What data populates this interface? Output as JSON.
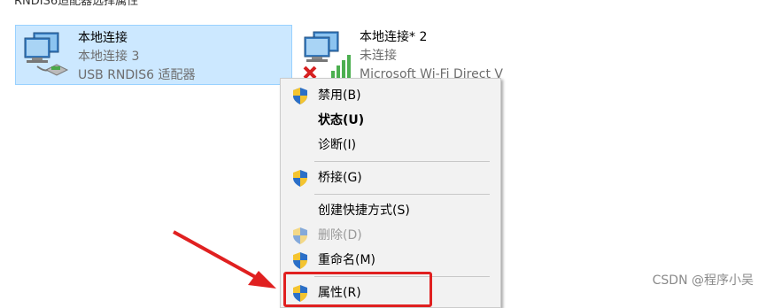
{
  "top_caption": "RNDIS6适配器选择属性",
  "adapters": [
    {
      "name": "本地连接",
      "status": "本地连接 3",
      "device": "USB RNDIS6 适配器",
      "selected": true
    },
    {
      "name": "本地连接* 2",
      "status": "未连接",
      "device": "Microsoft Wi-Fi Direct V",
      "selected": false
    }
  ],
  "context_menu": {
    "items": [
      {
        "label": "禁用(B)",
        "icon": "uac-shield-icon",
        "bold": false,
        "disabled": false
      },
      {
        "label": "状态(U)",
        "icon": "",
        "bold": true,
        "disabled": false
      },
      {
        "label": "诊断(I)",
        "icon": "",
        "bold": false,
        "disabled": false
      },
      {
        "label": "桥接(G)",
        "icon": "uac-shield-icon",
        "bold": false,
        "disabled": false
      },
      {
        "label": "创建快捷方式(S)",
        "icon": "",
        "bold": false,
        "disabled": false
      },
      {
        "label": "删除(D)",
        "icon": "uac-shield-icon",
        "bold": false,
        "disabled": true
      },
      {
        "label": "重命名(M)",
        "icon": "uac-shield-icon",
        "bold": false,
        "disabled": false
      },
      {
        "label": "属性(R)",
        "icon": "uac-shield-icon",
        "bold": false,
        "disabled": false
      }
    ]
  },
  "annotation": {
    "arrow_color": "#e02020",
    "box_color": "#e02020"
  },
  "watermark": "CSDN @程序小吴"
}
